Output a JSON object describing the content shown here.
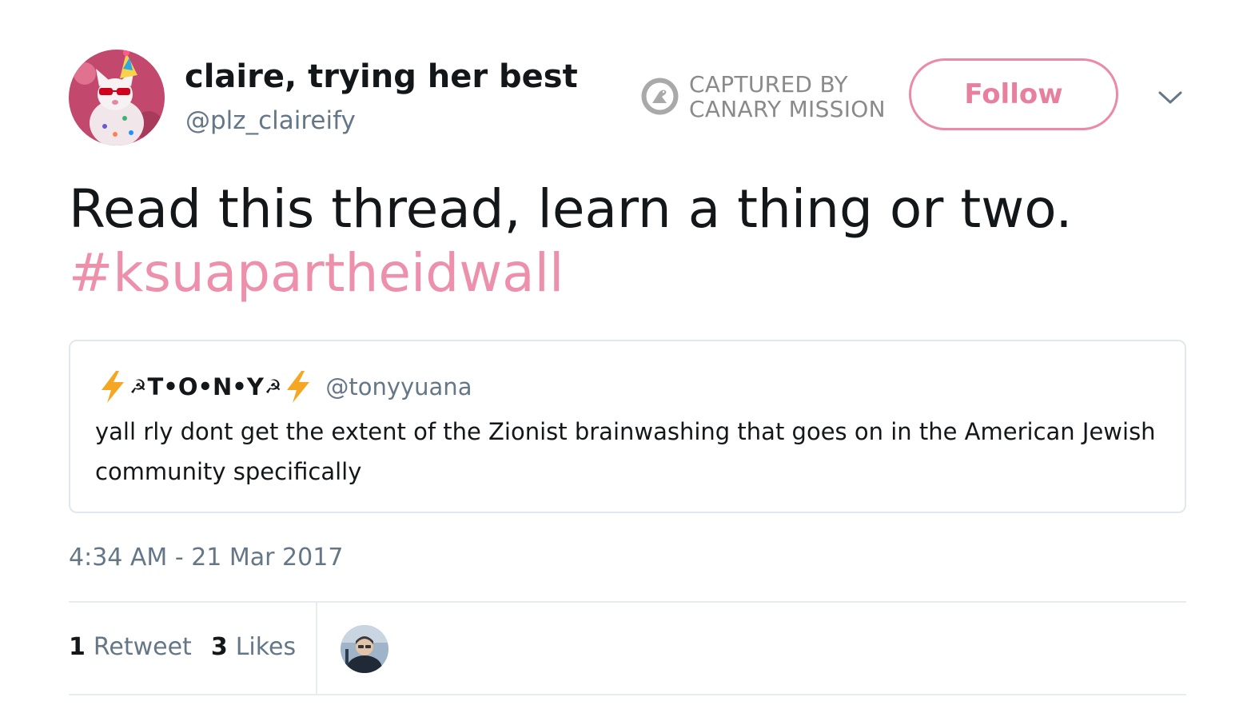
{
  "author": {
    "display_name": "claire, trying her best",
    "handle": "@plz_claireify",
    "avatar_icon": "party-hat-cat-avatar"
  },
  "watermark": {
    "line1": "CAPTURED BY",
    "line2": "CANARY MISSION",
    "icon": "canary-bird-logo"
  },
  "follow_button": {
    "label": "Follow"
  },
  "menu": {
    "icon": "chevron-down-icon"
  },
  "tweet": {
    "text": "Read this thread, learn a thing or two.",
    "hashtag": "#ksuapartheidwall"
  },
  "quoted_tweet": {
    "name_prefix_icon": "lightning-bolt",
    "name": "T•O•N•Y",
    "name_icon": "☭",
    "handle": "@tonyyuana",
    "text": "yall rly dont get the extent of the Zionist brainwashing that goes on in the American Jewish community specifically"
  },
  "timestamp": "4:34 AM - 21 Mar 2017",
  "stats": {
    "retweets_count": "1",
    "retweets_label": "Retweet",
    "likes_count": "3",
    "likes_label": "Likes"
  },
  "liker": {
    "avatar_icon": "liker-avatar"
  },
  "colors": {
    "accent": "#e7809f",
    "hashtag": "#ed90ac",
    "secondary_text": "#657786",
    "primary_text": "#14171a",
    "border": "#e1e8ed",
    "bolt": "#f5a623"
  }
}
